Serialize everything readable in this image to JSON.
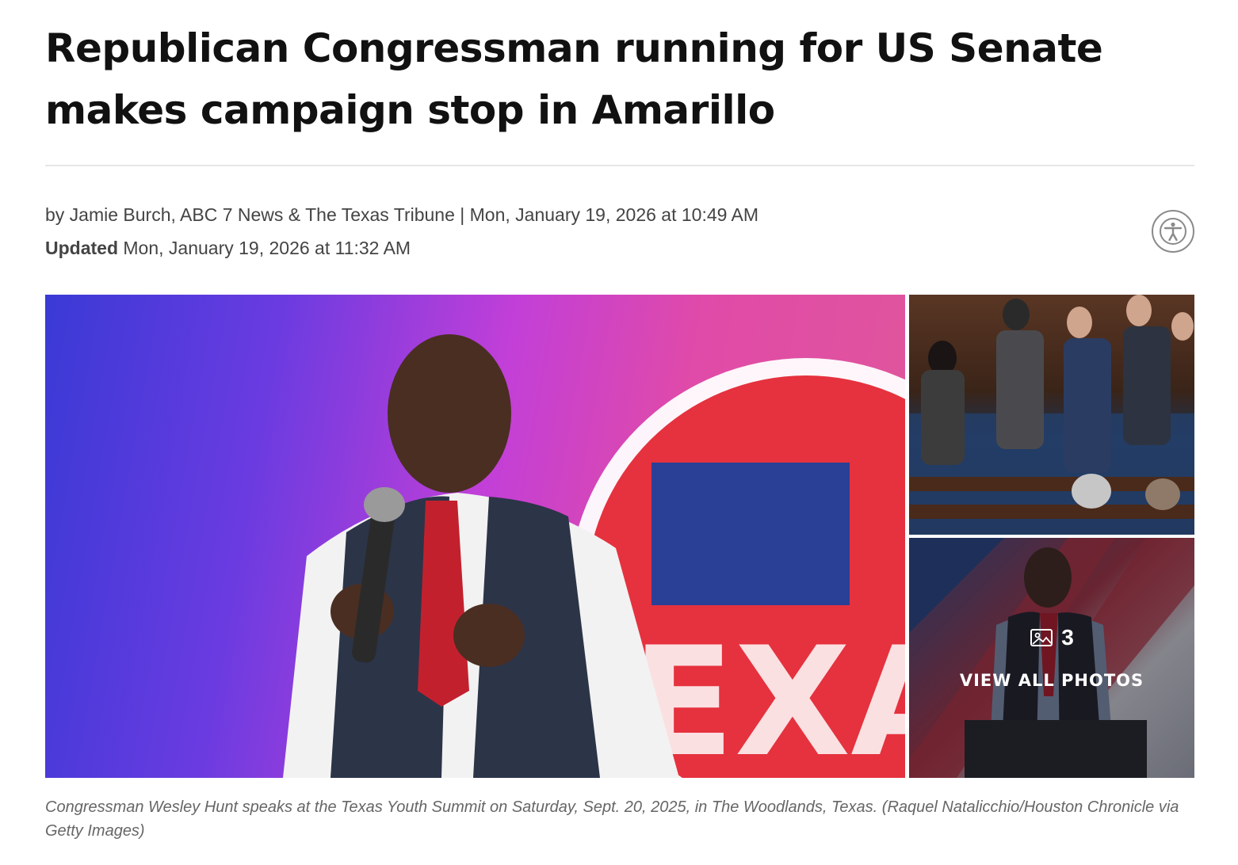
{
  "article": {
    "headline": "Republican Congressman running for US Senate makes campaign stop in Amarillo",
    "byline": "by Jamie Burch, ABC 7 News & The Texas Tribune | Mon, January 19, 2026 at 10:49 AM",
    "updated_label": "Updated",
    "updated_time": "Mon, January 19, 2026 at 11:32 AM"
  },
  "accessibility": {
    "icon": "accessibility-icon"
  },
  "gallery": {
    "main_photo_text": "EXA",
    "photo_count": "3",
    "view_all_label": "VIEW ALL PHOTOS",
    "caption": "Congressman Wesley Hunt speaks at the Texas Youth Summit on Saturday, Sept. 20, 2025, in The Woodlands, Texas. (Raquel Natalicchio/Houston Chronicle via Getty Images)"
  },
  "colors": {
    "headline": "#111111",
    "meta_text": "#444444",
    "caption_text": "#666666",
    "divider": "#e6e6e6"
  }
}
